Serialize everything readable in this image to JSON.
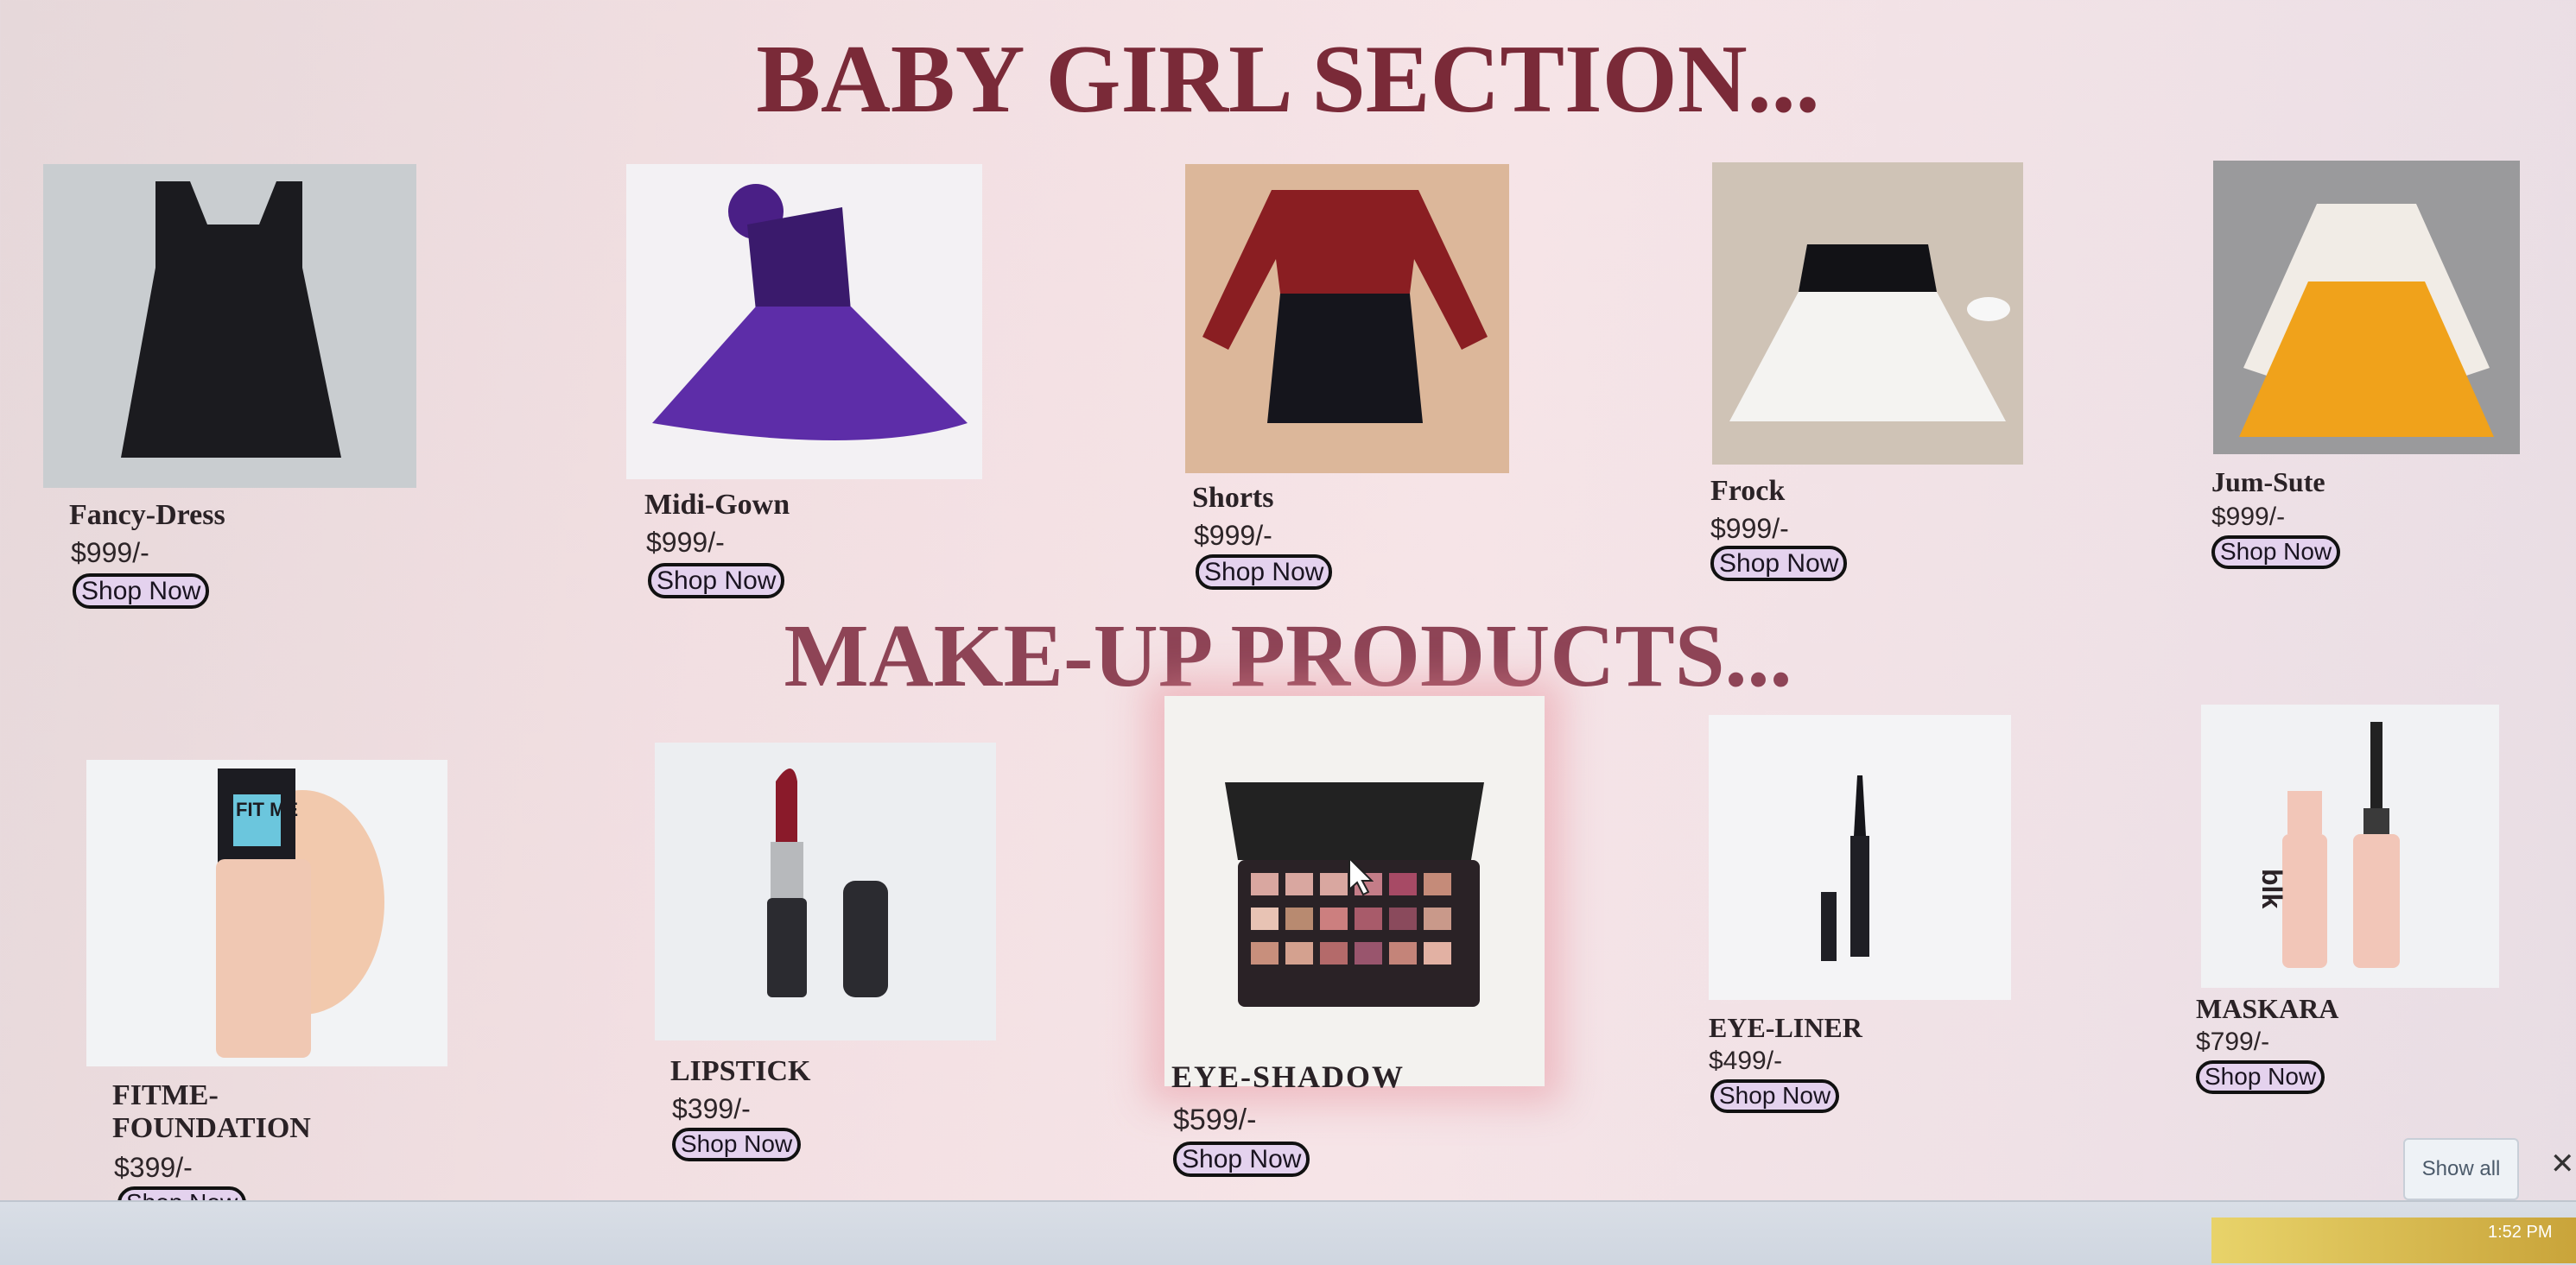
{
  "sections": {
    "baby_girl": {
      "title": "BABY GIRL SECTION...",
      "products": [
        {
          "name": "Fancy-Dress",
          "price": "$999/-",
          "button": "Shop Now"
        },
        {
          "name": "Midi-Gown",
          "price": "$999/-",
          "button": "Shop Now"
        },
        {
          "name": "Shorts",
          "price": "$999/-",
          "button": "Shop Now"
        },
        {
          "name": "Frock",
          "price": "$999/-",
          "button": "Shop Now"
        },
        {
          "name": "Jum-Sute",
          "price": "$999/-",
          "button": "Shop Now"
        }
      ]
    },
    "makeup": {
      "title": "MAKE-UP PRODUCTS...",
      "products": [
        {
          "name_line1": "FITME-",
          "name_line2": "FOUNDATION",
          "price": "$399/-",
          "button": "Shop Now"
        },
        {
          "name": "LIPSTICK",
          "price": "$399/-",
          "button": "Shop Now"
        },
        {
          "name": "EYE-SHADOW",
          "price": "$599/-",
          "button": "Shop Now"
        },
        {
          "name": "EYE-LINER",
          "price": "$499/-",
          "button": "Shop Now"
        },
        {
          "name": "MASKARA",
          "price": "$799/-",
          "button": "Shop Now"
        }
      ]
    }
  },
  "image_labels": {
    "foundation_brand": "FIT ME",
    "mascara_brand": "blk"
  },
  "download_bar": {
    "show_all": "Show all",
    "close": "✕"
  },
  "taskbar": {
    "time": "1:52 PM"
  },
  "colors": {
    "baby_heading": "#7a2a38",
    "makeup_heading": "#8e4456",
    "button_bg": "#e4d2ee"
  }
}
